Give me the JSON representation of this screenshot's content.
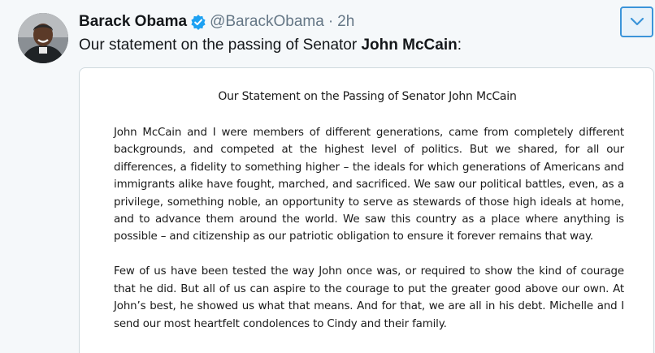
{
  "tweet": {
    "author": {
      "display_name": "Barack Obama",
      "handle": "@BarackObama",
      "verified": true,
      "avatar_icon": "avatar-photo"
    },
    "separator": "·",
    "time": "2h",
    "text_prefix": "Our statement on the passing of Senator ",
    "text_bold": "John McCain",
    "text_suffix": ":",
    "menu_icon": "chevron-down-icon"
  },
  "statement": {
    "title": "Our Statement on the Passing of Senator John McCain",
    "paragraphs": [
      "John McCain and I were members of different generations, came from completely different backgrounds, and competed at the highest level of politics. But we shared, for all our differences, a fidelity to something higher – the ideals for which generations of Americans and immigrants alike have fought, marched, and sacrificed. We saw our political battles, even, as a privilege, something noble, an opportunity to serve as stewards of those high ideals at home, and to advance them around the world. We saw this country as a place where anything is possible – and citizenship as our patriotic obligation to ensure it forever remains that way.",
      "Few of us have been tested the way John once was, or required to show the kind of courage that he did. But all of us can aspire to the courage to put the greater good above our own. At John’s best, he showed us what that means. And for that, we are all in his debt. Michelle and I send our most heartfelt condolences to Cindy and their family."
    ]
  },
  "colors": {
    "background": "#f5f8fa",
    "verified_blue": "#1da1f2",
    "caret_border": "#3b94d9",
    "muted_text": "#657786"
  }
}
